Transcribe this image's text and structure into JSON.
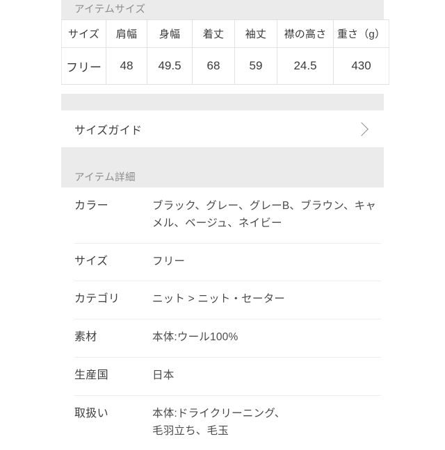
{
  "sections": {
    "item_size": {
      "band_label": "アイテムサイズ",
      "table": {
        "headers": [
          "サイズ",
          "肩幅",
          "身幅",
          "着丈",
          "袖丈",
          "襟の高さ",
          "重さ（g）"
        ],
        "rows": [
          [
            "フリー",
            "48",
            "49.5",
            "68",
            "59",
            "24.5",
            "430"
          ]
        ]
      }
    },
    "size_guide": {
      "label": "サイズガイド",
      "chevron": "chevron-right-icon"
    },
    "item_detail": {
      "band_label": "アイテム詳細",
      "rows": [
        {
          "label": "カラー",
          "value": "ブラック、グレー、グレーB、ブラウン、キャメル、ベージュ、ネイビー"
        },
        {
          "label": "サイズ",
          "value": "フリー"
        },
        {
          "label": "カテゴリ",
          "value": "ニット > ニット・セーター"
        },
        {
          "label": "素材",
          "value": "本体:ウール100%"
        },
        {
          "label": "生産国",
          "value": "日本"
        },
        {
          "label": "取扱い",
          "value": "本体:ドライクリーニング、\n毛羽立ち、毛玉"
        }
      ]
    }
  },
  "colors": {
    "page_background": "#ffffff",
    "band_background": "#ebebeb",
    "band_text": "#8d8d8d",
    "table_border": "#e2e2e2",
    "primary_text": "#3a3a3a",
    "separator": "#ededed"
  }
}
